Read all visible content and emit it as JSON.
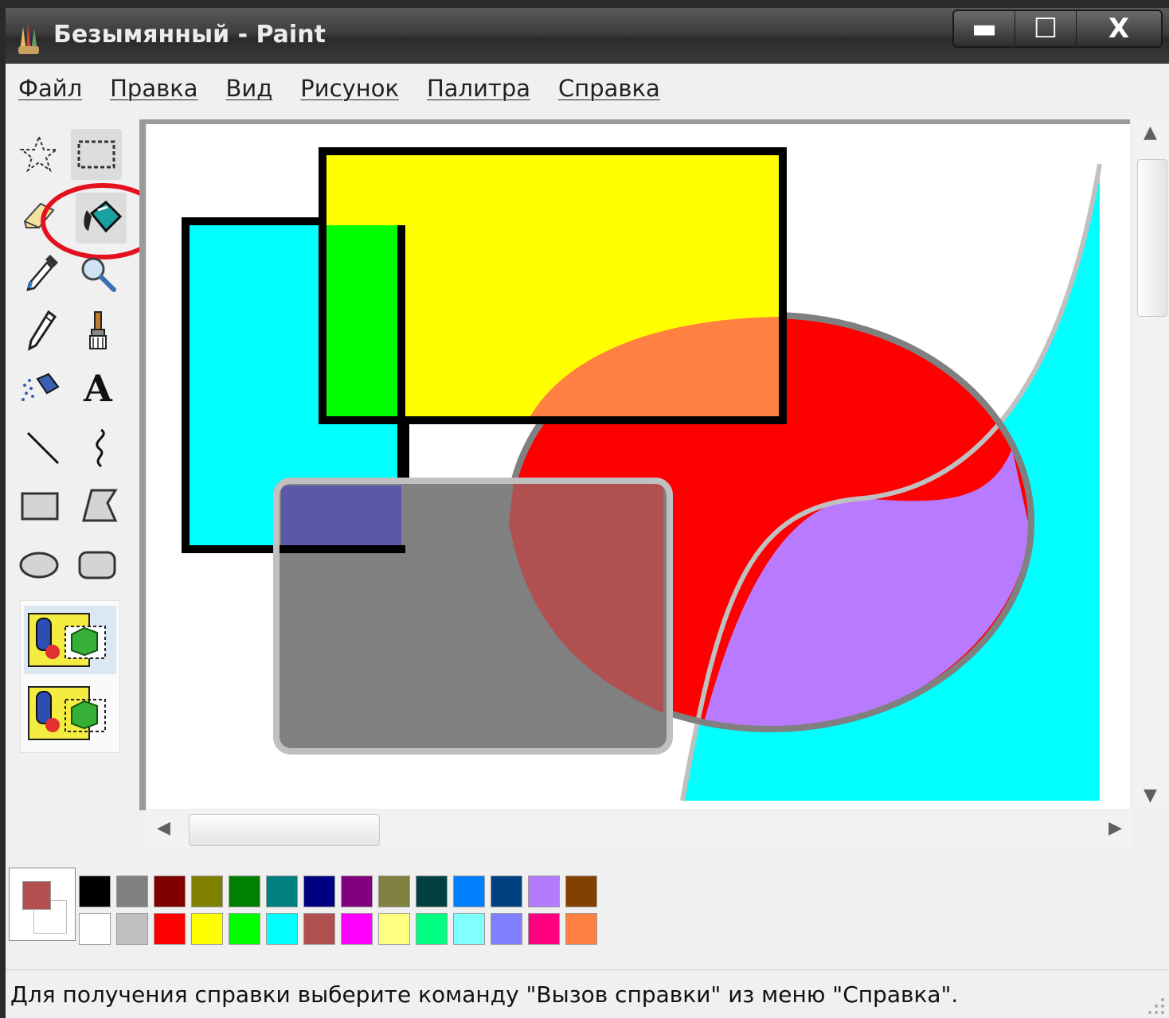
{
  "window": {
    "title": "Безымянный - Paint",
    "buttons": {
      "minimize": "▬",
      "maximize": "☐",
      "close": "X"
    }
  },
  "menu": [
    "Файл",
    "Правка",
    "Вид",
    "Рисунок",
    "Палитра",
    "Справка"
  ],
  "tools": {
    "active": "fill-with-color",
    "highlighted": "fill-with-color",
    "text_glyph": "A"
  },
  "palette": {
    "foreground": "#b55050",
    "background": "#ffffff",
    "top_row": [
      "#000000",
      "#808080",
      "#800000",
      "#808000",
      "#008000",
      "#008080",
      "#000080",
      "#800080",
      "#808040",
      "#004040",
      "#0080ff",
      "#004080",
      "#b57bff",
      "#804000"
    ],
    "bottom_row": [
      "#ffffff",
      "#c0c0c0",
      "#ff0000",
      "#ffff00",
      "#00ff00",
      "#00ffff",
      "#b05050",
      "#ff00ff",
      "#ffff80",
      "#00ff80",
      "#80ffff",
      "#8080ff",
      "#ff0080",
      "#ff8040"
    ]
  },
  "status": {
    "text": "Для получения справки выберите команду \"Вызов справки\" из меню \"Справка\"."
  }
}
